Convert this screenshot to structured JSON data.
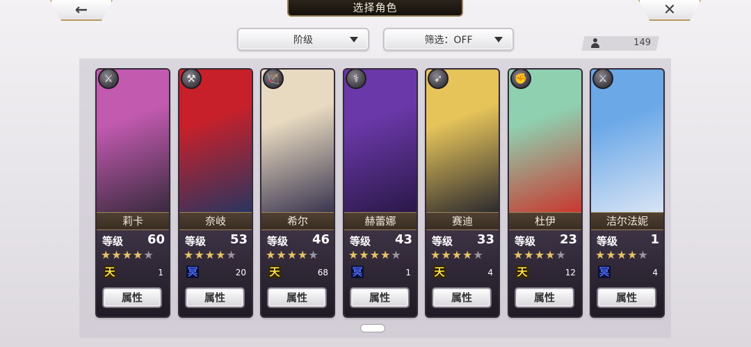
{
  "header": {
    "title": "选择角色",
    "back_icon": "←",
    "close_icon": "✕"
  },
  "filters": {
    "rank_label": "阶级",
    "filter_label": "筛选：OFF"
  },
  "roster_count": "149",
  "ui": {
    "attribute_button": "属性",
    "level_label": "等级"
  },
  "characters": [
    {
      "name": "莉卡",
      "level": "60",
      "stars": 4,
      "rank": "天",
      "rank_type": "sky",
      "rank_count": "1",
      "weapon_icon": "⚔",
      "colors": [
        "#c25ab0",
        "#3a2a3e"
      ]
    },
    {
      "name": "奈岐",
      "level": "53",
      "stars": 4,
      "rank": "冥",
      "rank_type": "dark",
      "rank_count": "20",
      "weapon_icon": "⚒",
      "colors": [
        "#c8202a",
        "#2a3560"
      ]
    },
    {
      "name": "希尔",
      "level": "46",
      "stars": 4,
      "rank": "天",
      "rank_type": "sky",
      "rank_count": "68",
      "weapon_icon": "🏹",
      "colors": [
        "#e8dac0",
        "#3a3550"
      ]
    },
    {
      "name": "赫蕾娜",
      "level": "43",
      "stars": 4,
      "rank": "冥",
      "rank_type": "dark",
      "rank_count": "1",
      "weapon_icon": "⚕",
      "colors": [
        "#6a38a8",
        "#2a1848"
      ]
    },
    {
      "name": "赛迪",
      "level": "33",
      "stars": 4,
      "rank": "天",
      "rank_type": "sky",
      "rank_count": "4",
      "weapon_icon": "➶",
      "colors": [
        "#e6c45a",
        "#2c2a2e"
      ]
    },
    {
      "name": "杜伊",
      "level": "23",
      "stars": 4,
      "rank": "天",
      "rank_type": "sky",
      "rank_count": "12",
      "weapon_icon": "✊",
      "colors": [
        "#8fd0b0",
        "#c8382e"
      ]
    },
    {
      "name": "洁尔法妮",
      "level": "1",
      "stars": 4,
      "rank": "冥",
      "rank_type": "dark",
      "rank_count": "4",
      "weapon_icon": "⚔",
      "colors": [
        "#6aa8e8",
        "#d8e4f4"
      ]
    }
  ]
}
